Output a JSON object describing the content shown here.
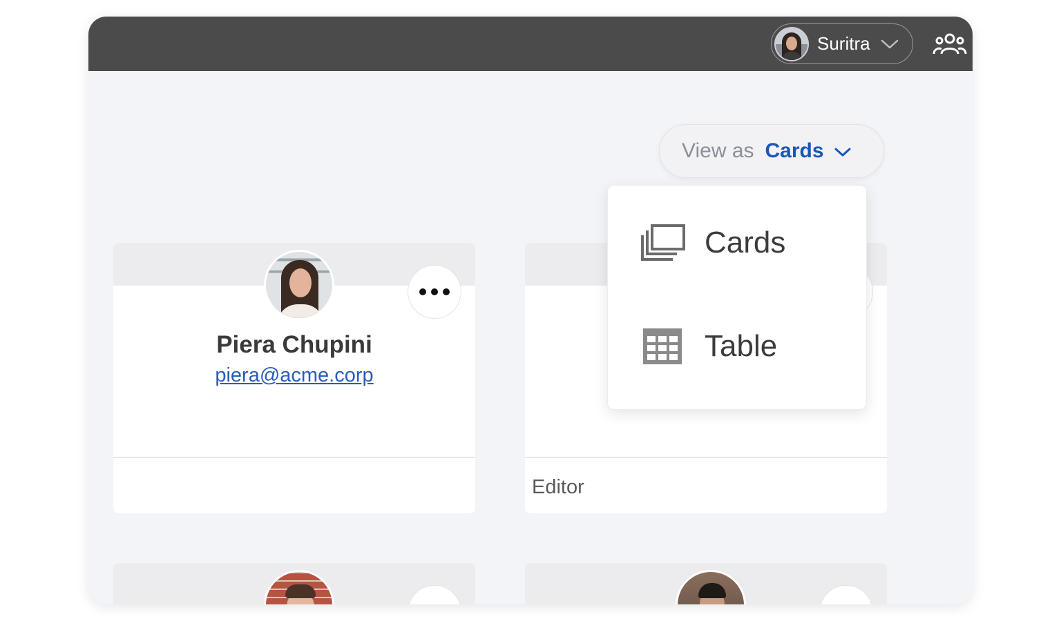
{
  "topbar": {
    "user_name": "Suritra",
    "user_menu_icon": "chevron-down-icon",
    "team_icon": "team-icon"
  },
  "view_as": {
    "label": "View as",
    "value": "Cards"
  },
  "view_menu": {
    "items": [
      {
        "label": "Cards",
        "icon": "cards-icon"
      },
      {
        "label": "Table",
        "icon": "table-icon"
      }
    ]
  },
  "cards": [
    {
      "name": "Piera Chupini",
      "email": "piera@acme.corp",
      "role": ""
    },
    {
      "name": "",
      "email": "",
      "role": "Editor"
    },
    {
      "name": "",
      "email": "",
      "role": ""
    },
    {
      "name": "",
      "email": "",
      "role": ""
    }
  ],
  "colors": {
    "topbar": "#4b4b4b",
    "accent": "#1b56b8",
    "link": "#2b5cb6",
    "page_bg": "#f3f4f8"
  }
}
